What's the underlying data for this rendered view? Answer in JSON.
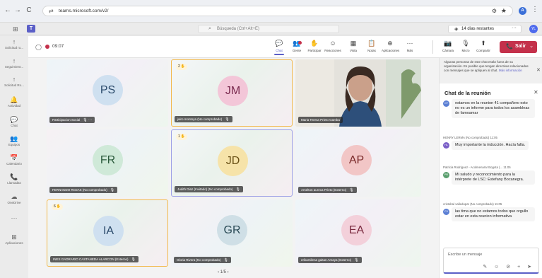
{
  "browser": {
    "url": "teams.microsoft.com/v2/",
    "nav": {
      "back": "←",
      "forward": "→",
      "reload": "C"
    },
    "profile_initial": "A"
  },
  "header": {
    "search_placeholder": "Búsqueda (Ctrl+Alt+E)",
    "trial_label": "14 días restantes",
    "trial_more": "···",
    "avatar": "YL"
  },
  "rail": {
    "items": [
      {
        "icon": "↑",
        "label": "Solicitud ro..."
      },
      {
        "icon": "↑",
        "label": "Seguimient..."
      },
      {
        "icon": "↑",
        "label": "Solicitud Ro..."
      },
      {
        "icon": "🔔",
        "label": "Actividad"
      },
      {
        "icon": "💬",
        "label": "Chat"
      },
      {
        "icon": "👥",
        "label": "Equipos"
      },
      {
        "icon": "📅",
        "label": "Calendario"
      },
      {
        "icon": "📞",
        "label": "Llamadas"
      },
      {
        "icon": "☁",
        "label": "OneDrive"
      },
      {
        "icon": "···",
        "label": ""
      },
      {
        "icon": "⊞",
        "label": "Aplicaciones"
      }
    ]
  },
  "meeting": {
    "timer": "09:07",
    "toolbar": [
      {
        "id": "chat",
        "icon": "💬",
        "label": "Chat",
        "active": true
      },
      {
        "id": "people",
        "icon": "👥",
        "label": "Gente",
        "active": false,
        "notify": true
      },
      {
        "id": "raise",
        "icon": "✋",
        "label": "Participar",
        "active": false
      },
      {
        "id": "react",
        "icon": "☺",
        "label": "Reacciones",
        "active": false
      },
      {
        "id": "view",
        "icon": "▦",
        "label": "Vista",
        "active": false
      },
      {
        "id": "notes",
        "icon": "📋",
        "label": "Notas",
        "active": false
      },
      {
        "id": "apps",
        "icon": "⊕",
        "label": "Aplicaciones",
        "active": false
      },
      {
        "id": "more",
        "icon": "···",
        "label": "Más",
        "active": false
      },
      {
        "id": "camera",
        "icon": "📷",
        "label": "Cámara",
        "active": false
      },
      {
        "id": "mic",
        "icon": "🎙",
        "label": "Micro",
        "active": false
      },
      {
        "id": "share",
        "icon": "⬆",
        "label": "Compartir",
        "active": false
      }
    ],
    "leave": {
      "icon": "📞",
      "label": "Salir",
      "chevron": "⌄"
    },
    "pager": "‹  1/5  ›"
  },
  "tiles": [
    {
      "initials": "PS",
      "name": "Participacion Social",
      "mic": "🎙 ···",
      "bg": "#cfe0f0",
      "fg": "#2b4a6b",
      "style": "b1"
    },
    {
      "initials": "JM",
      "name": "jairo montoya (No comprobado)",
      "mic": "🎙",
      "bg": "#f3c6d8",
      "fg": "#7a2a4f",
      "badge": "2",
      "style": "speaking"
    },
    {
      "initials": "",
      "name": "Maria Teresa Prieto Gamba",
      "mic": "",
      "video": true
    },
    {
      "initials": "FR",
      "name": "FERNANDO ROJAS (No comprobado)",
      "mic": "🎙",
      "bg": "#cfe9d8",
      "fg": "#2a5a3b",
      "style": "b2"
    },
    {
      "initials": "JD",
      "name": "Judith Diaz (Invitado) (No comprobado)",
      "mic": "🎙",
      "bg": "#f6e3a9",
      "fg": "#6a5117",
      "badge": "1",
      "style": "pinned"
    },
    {
      "initials": "AP",
      "name": "Amelton aureca Prieto (Externo)",
      "mic": "🎙",
      "bg": "#f2c6c6",
      "fg": "#7a2a2a",
      "style": "b1"
    },
    {
      "initials": "IA",
      "name": "INES GADRARIO CASTANEDA ALARCON (Externo)",
      "mic": "🎙",
      "bg": "#cfe0f0",
      "fg": "#2b4a6b",
      "badge": "6",
      "style": "speaking"
    },
    {
      "initials": "GR",
      "name": "Gloria Rivera (No comprobado)",
      "mic": "🎙",
      "bg": "#cfdfe6",
      "fg": "#2a4a55",
      "style": "b2"
    },
    {
      "initials": "EA",
      "name": "erikamilena gaitan Amaya (Externo)",
      "mic": "🎙",
      "bg": "#f3d0da",
      "fg": "#7a2a3f",
      "style": "b1"
    }
  ],
  "chat": {
    "banner": "Algunas personas de este chat están fuera de su organización. Es posible que tengan directivas relacionadas con mensajes que se apliquen al chat.",
    "banner_link": "Más información",
    "title": "Chat de la reunión",
    "messages": [
      {
        "meta": "",
        "initials": "CT",
        "color": "#5b7fd4",
        "text": "estamos en la reunion 41 compañero esto no es un informe para todos los asambleas de famoamar"
      },
      {
        "meta": "HENRY LERMA (No comprobado)  11:05",
        "initials": "HL",
        "color": "#7a5fc7",
        "text": "Muy importante la inducción. Hacía falta."
      },
      {
        "meta": "Patricia Rodriguez - Acolmenarar Bogota (... 11:05",
        "initials": "PR",
        "color": "#5a9f6e",
        "text": "Mi saludo y reconocimiento para la intérprete de LSC: Estefany Bocanegra."
      },
      {
        "meta": "cristobal valledupar (No comprobado)  11:05",
        "initials": "CV",
        "color": "#5b7fd4",
        "text": "las tima que no estamos todos que orgullo estar en esta reunion informativa"
      }
    ],
    "composer_placeholder": "Escribe un mensaje",
    "composer_tools": "✎ ☺ ⊘ + ➤"
  }
}
